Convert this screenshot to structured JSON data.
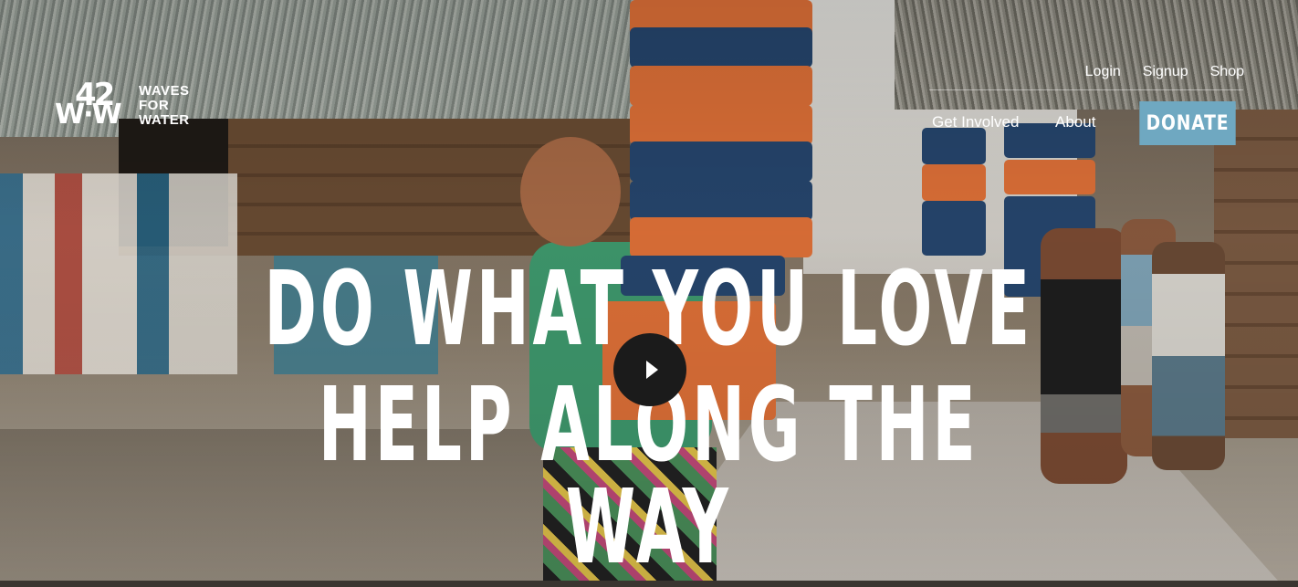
{
  "brand": {
    "mark_top": "42",
    "mark_bottom": "W·W",
    "name_lines": [
      "WAVES",
      "FOR",
      "WATER"
    ]
  },
  "nav": {
    "top": [
      "Login",
      "Signup",
      "Shop"
    ],
    "main": [
      "Get Involved",
      "About"
    ],
    "donate_label": "DONATE"
  },
  "hero": {
    "line1": "DO WHAT YOU LOVE",
    "line2": "HELP ALONG THE WAY",
    "play_icon": "play-icon"
  },
  "colors": {
    "donate_bg": "#6fa8c1",
    "text": "#ffffff",
    "play_bg": "#1b1b1b"
  }
}
